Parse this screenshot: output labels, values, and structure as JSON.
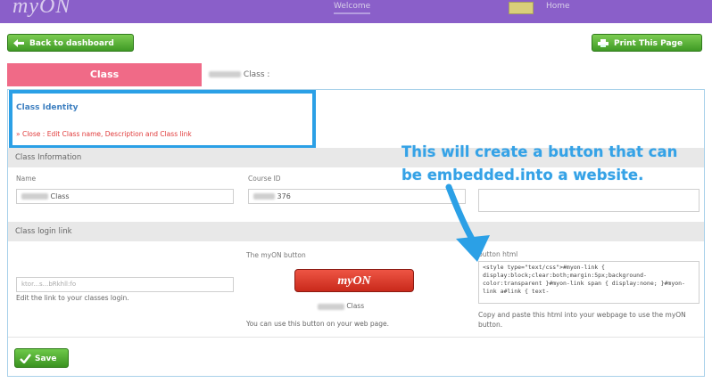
{
  "brand": {
    "logo_text": "myON",
    "accent": "#8a5fc9"
  },
  "topnav": {
    "welcome": "Welcome",
    "home": "Home"
  },
  "toolbar": {
    "back_label": "Back to dashboard",
    "print_label": "Print This Page"
  },
  "tabs": {
    "class_tab": "Class",
    "class_title_suffix": "Class :"
  },
  "identity": {
    "title": "Class Identity",
    "link_text": "Close : Edit Class name, Description and Class link"
  },
  "class_information": {
    "section_title": "Class Information",
    "name_label": "Name",
    "name_value": "Class",
    "course_label": "Course ID",
    "course_value": "376"
  },
  "login_link": {
    "section_title": "Class login link",
    "link_value": "ktor...s...bRkhll:fo",
    "help_text": "Edit the link to your classes login.",
    "button_heading": "The myON button",
    "button_text": "myON",
    "class_caption": "Class",
    "button_help": "You can use this button on your web page.",
    "html_label": "button html",
    "html_code": "<style type=\"text/css\">#myon-link { display:block;clear:both;margin:5px;background-color:transparent }#myon-link span { display:none; }#myon-link a#link { text-",
    "html_help": "Copy and paste this html into your webpage to use the myON button."
  },
  "annotation": {
    "line1": "This will create a button that can",
    "line2": "be embedded.into a website."
  },
  "footer": {
    "save_label": "Save"
  }
}
